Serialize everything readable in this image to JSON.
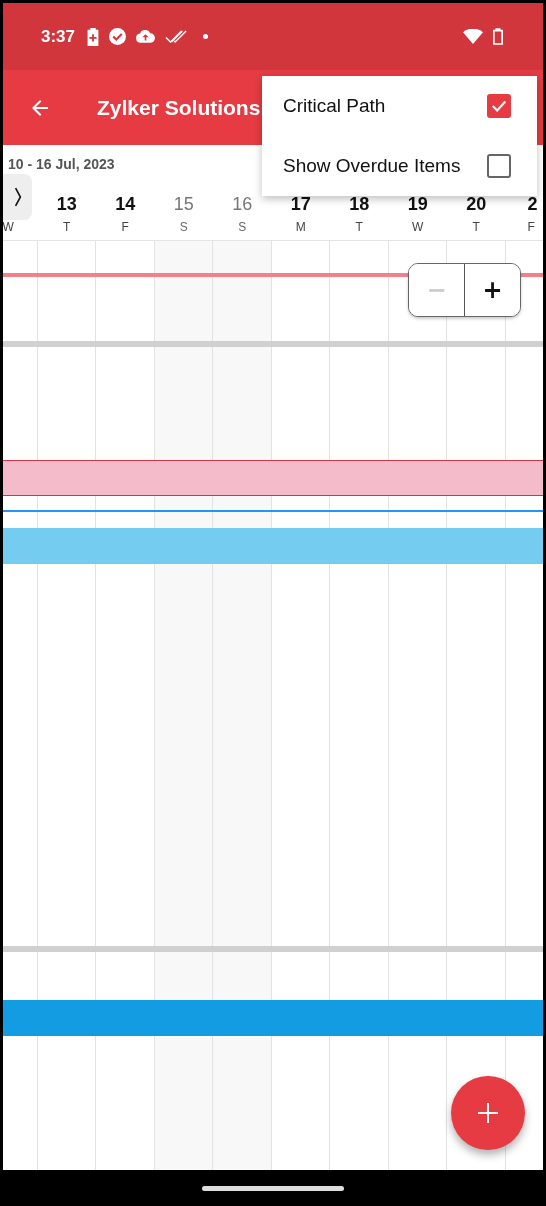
{
  "status_bar": {
    "time": "3:37"
  },
  "app_bar": {
    "title": "Zylker Solutions"
  },
  "header": {
    "date_range": "10 - 16 Jul, 2023"
  },
  "days": [
    {
      "letter": "W",
      "weekend": false
    },
    {
      "number": "13",
      "letter": "T",
      "weekend": false
    },
    {
      "number": "14",
      "letter": "F",
      "weekend": false
    },
    {
      "number": "15",
      "letter": "S",
      "weekend": true
    },
    {
      "number": "16",
      "letter": "S",
      "weekend": true
    },
    {
      "number": "17",
      "letter": "M",
      "weekend": false
    },
    {
      "number": "18",
      "letter": "T",
      "weekend": false
    },
    {
      "number": "19",
      "letter": "W",
      "weekend": false
    },
    {
      "number": "20",
      "letter": "T",
      "weekend": false
    },
    {
      "number": "2",
      "letter": "F",
      "weekend": false
    }
  ],
  "gantt_items": [
    {
      "kind": "line",
      "color": "#f47f8a"
    },
    {
      "kind": "separator"
    },
    {
      "kind": "bar",
      "color": "#f4bccb",
      "critical": true
    },
    {
      "kind": "line",
      "color": "#2196f3"
    },
    {
      "kind": "bar",
      "color": "#74cdf0",
      "critical": false
    },
    {
      "kind": "separator"
    },
    {
      "kind": "bar",
      "color": "#149ce2",
      "critical": false
    }
  ],
  "zoom_control": [
    {
      "label": "−",
      "disabled": true
    },
    {
      "label": "+",
      "disabled": false
    }
  ],
  "menu": [
    {
      "label": "Critical Path",
      "kind": "checkbox",
      "checked": true
    },
    {
      "label": "Show Overdue Items",
      "kind": "checkbox",
      "checked": false
    }
  ]
}
